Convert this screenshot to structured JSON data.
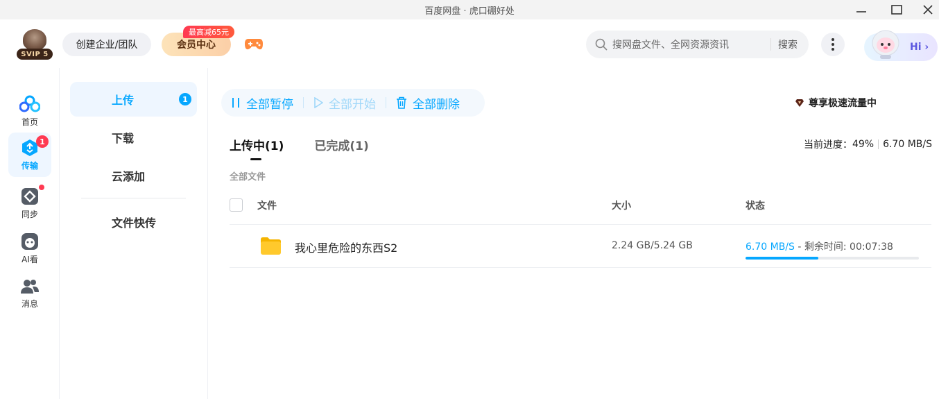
{
  "window": {
    "title": "百度网盘 · 虎口硼好处"
  },
  "header": {
    "vip_level": "SVIP 5",
    "team_button": "创建企业/团队",
    "vip_center_button": "会员中心",
    "promo_badge": "最高减65元",
    "search": {
      "placeholder": "搜网盘文件、全网资源资讯",
      "button": "搜索"
    },
    "hi_label": "Hi",
    "colors": {
      "accent": "#06a7ff",
      "promo": "#ff3a52",
      "vip": "#fbcfa7"
    }
  },
  "left_nav": [
    {
      "label": "首页",
      "icon": "home-icon"
    },
    {
      "label": "传输",
      "icon": "transfer-icon",
      "badge": "1",
      "active": true
    },
    {
      "label": "同步",
      "icon": "sync-icon",
      "dot": true
    },
    {
      "label": "AI看",
      "icon": "ai-watch-icon"
    },
    {
      "label": "消息",
      "icon": "message-icon"
    }
  ],
  "sub_nav": [
    {
      "label": "上传",
      "badge": "1",
      "active": true
    },
    {
      "label": "下载"
    },
    {
      "label": "云添加"
    },
    {
      "label": "文件快传"
    }
  ],
  "toolbar": {
    "pause_all": "全部暂停",
    "start_all": "全部开始",
    "delete_all": "全部删除",
    "speed_tag": "尊享极速流量中"
  },
  "tabs": [
    {
      "label": "上传中(1)",
      "active": true
    },
    {
      "label": "已完成(1)"
    }
  ],
  "progress_summary": {
    "label": "当前进度：",
    "percent": "49%",
    "speed": "6.70 MB/S"
  },
  "section_label": "全部文件",
  "table": {
    "headers": {
      "file": "文件",
      "size": "大小",
      "status": "状态"
    },
    "rows": [
      {
        "name": "我心里危险的东西S2",
        "size": "2.24 GB/5.24 GB",
        "speed": "6.70 MB/S",
        "remaining": " - 剩余时间: 00:07:38",
        "progress": 0.42
      }
    ]
  }
}
